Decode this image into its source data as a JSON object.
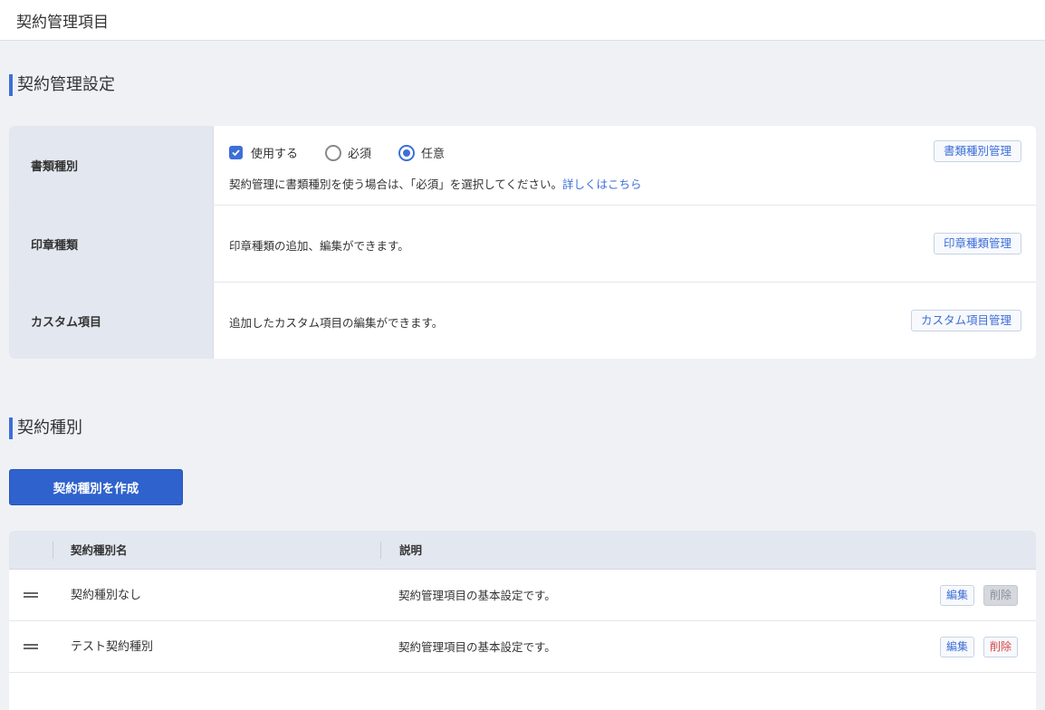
{
  "header": {
    "title": "契約管理項目"
  },
  "settings_section": {
    "heading": "契約管理設定",
    "rows": [
      {
        "label": "書類種別",
        "checkbox_label": "使用する",
        "checkbox_checked": true,
        "radio_options": [
          {
            "label": "必須",
            "selected": false
          },
          {
            "label": "任意",
            "selected": true
          }
        ],
        "description": "契約管理に書類種別を使う場合は、「必須」を選択してください。",
        "link_text": "詳しくはこちら",
        "button": "書類種別管理"
      },
      {
        "label": "印章種類",
        "description": "印章種類の追加、編集ができます。",
        "button": "印章種類管理"
      },
      {
        "label": "カスタム項目",
        "description": "追加したカスタム項目の編集ができます。",
        "button": "カスタム項目管理"
      }
    ]
  },
  "contract_types_section": {
    "heading": "契約種別",
    "create_button": "契約種別を作成",
    "table": {
      "columns": [
        "契約種別名",
        "説明"
      ],
      "rows": [
        {
          "name": "契約種別なし",
          "description": "契約管理項目の基本設定です。",
          "edit": "編集",
          "delete": "削除",
          "delete_disabled": true
        },
        {
          "name": "テスト契約種別",
          "description": "契約管理項目の基本設定です。",
          "edit": "編集",
          "delete": "削除",
          "delete_disabled": false
        }
      ]
    }
  },
  "colors": {
    "accent": "#3e6fd8",
    "primary_button": "#2f62cc",
    "danger": "#d64545",
    "background": "#eff1f5",
    "label_cell": "#e3e7ef"
  }
}
